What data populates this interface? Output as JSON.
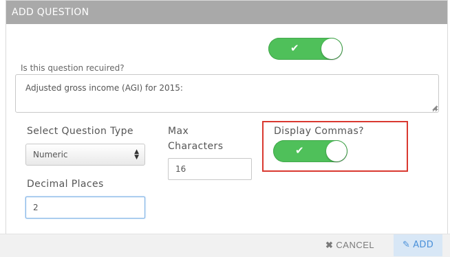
{
  "dialog": {
    "title": "ADD QUESTION"
  },
  "required": {
    "label": "Is this question recuired?",
    "value": true
  },
  "question_text": {
    "value": "Adjusted gross income (AGI) for 2015:"
  },
  "question_type": {
    "label": "Select Question Type",
    "selected": "Numeric"
  },
  "max_characters": {
    "label_line1": "Max",
    "label_line2": "Characters",
    "value": "16"
  },
  "decimal_places": {
    "label": "Decimal Places",
    "value": "2"
  },
  "display_commas": {
    "label": "Display Commas?",
    "value": true
  },
  "footer": {
    "cancel_label": "CANCEL",
    "add_label": "ADD"
  },
  "icons": {
    "check": "check-icon",
    "cancel": "x-icon",
    "add": "pencil-icon"
  },
  "colors": {
    "toggle_on": "#4fc05a",
    "header_bg": "#a9a9a9",
    "highlight": "#d9382f",
    "accent": "#4a90d9"
  }
}
